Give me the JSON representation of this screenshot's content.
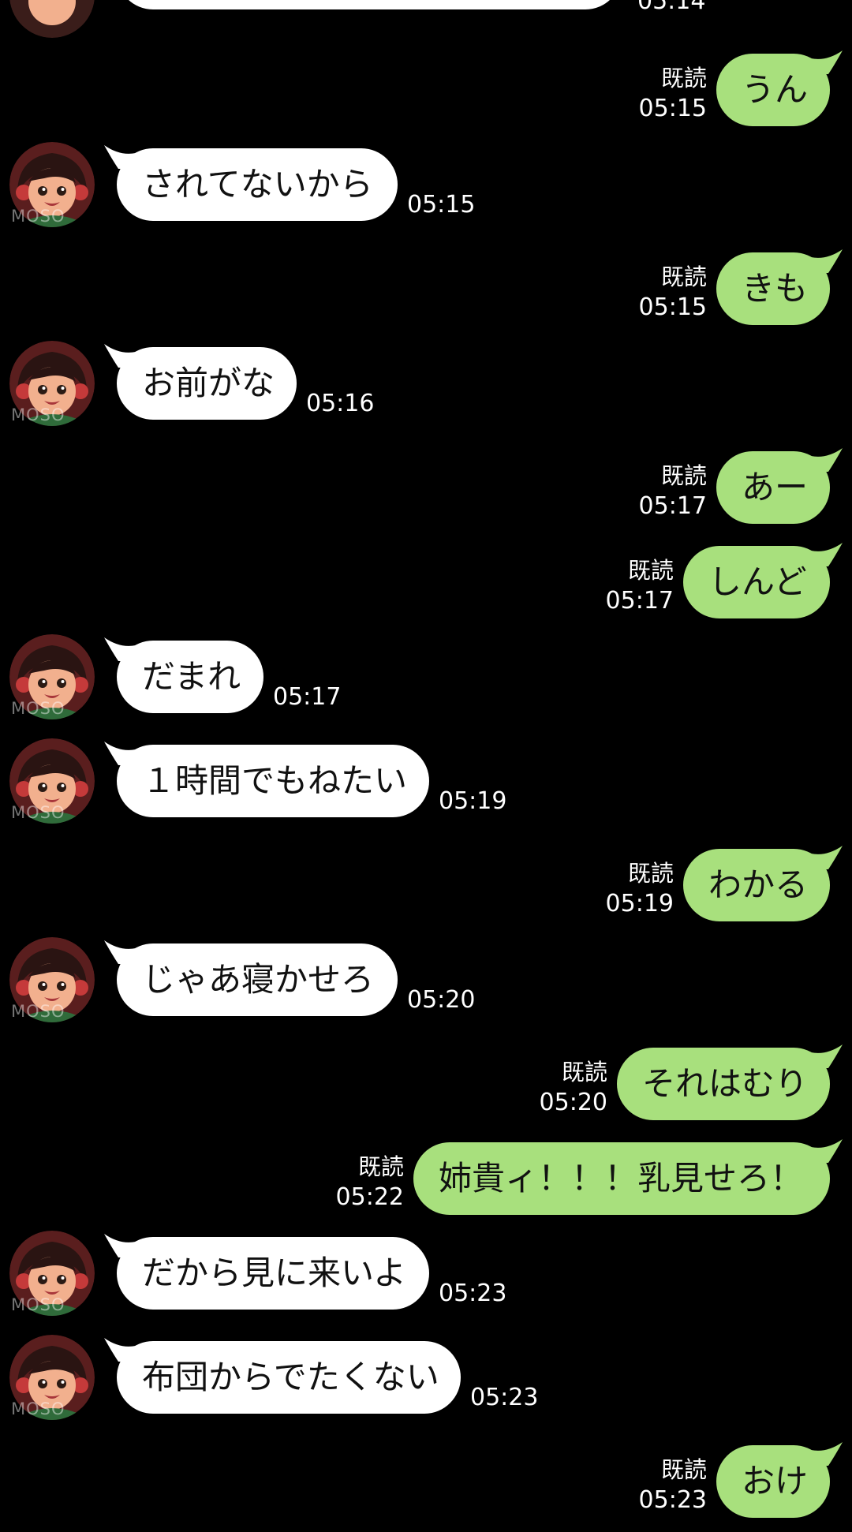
{
  "colors": {
    "background": "#000000",
    "incoming_bubble": "#ffffff",
    "outgoing_bubble": "#a8e07d",
    "text": "#111111"
  },
  "avatar_watermark": "MOSO",
  "top_partial_time": "05:14",
  "messages": [
    {
      "dir": "out",
      "text": "うん",
      "read": "既読",
      "time": "05:15"
    },
    {
      "dir": "in",
      "text": "されてないから",
      "time": "05:15"
    },
    {
      "dir": "out",
      "text": "きも",
      "read": "既読",
      "time": "05:15"
    },
    {
      "dir": "in",
      "text": "お前がな",
      "time": "05:16"
    },
    {
      "dir": "out",
      "text": "あー",
      "read": "既読",
      "time": "05:17"
    },
    {
      "dir": "out",
      "text": "しんど",
      "read": "既読",
      "time": "05:17"
    },
    {
      "dir": "in",
      "text": "だまれ",
      "time": "05:17"
    },
    {
      "dir": "in",
      "text": "１時間でもねたい",
      "time": "05:19"
    },
    {
      "dir": "out",
      "text": "わかる",
      "read": "既読",
      "time": "05:19"
    },
    {
      "dir": "in",
      "text": "じゃあ寝かせろ",
      "time": "05:20"
    },
    {
      "dir": "out",
      "text": "それはむり",
      "read": "既読",
      "time": "05:20"
    },
    {
      "dir": "out",
      "text": "姉貴ィ！！！乳見せろ！",
      "read": "既読",
      "time": "05:22"
    },
    {
      "dir": "in",
      "text": "だから見に来いよ",
      "time": "05:23"
    },
    {
      "dir": "in",
      "text": "布団からでたくない",
      "time": "05:23"
    },
    {
      "dir": "out",
      "text": "おけ",
      "read": "既読",
      "time": "05:23"
    }
  ]
}
